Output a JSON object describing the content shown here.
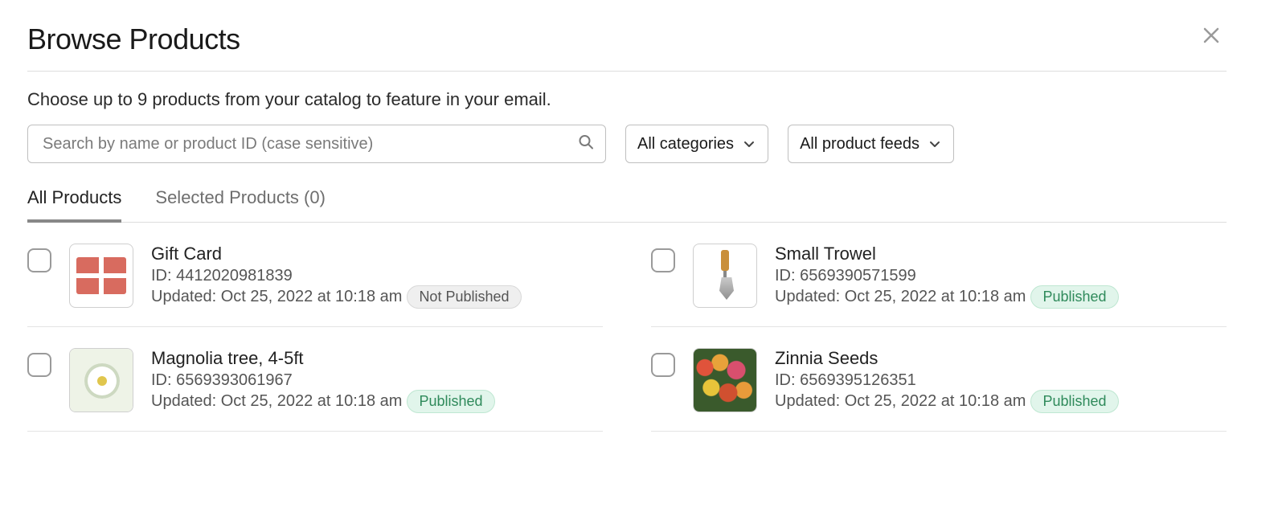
{
  "dialog": {
    "title": "Browse Products",
    "subtitle": "Choose up to 9 products from your catalog to feature in your email."
  },
  "search": {
    "placeholder": "Search by name or product ID (case sensitive)",
    "value": ""
  },
  "filters": {
    "category": "All categories",
    "feed": "All product feeds"
  },
  "tabs": {
    "all": "All Products",
    "selected_label": "Selected Products (0)",
    "selected_count": 0
  },
  "id_prefix": "ID: ",
  "updated_prefix": "Updated: ",
  "status_labels": {
    "published": "Published",
    "not_published": "Not Published"
  },
  "products": [
    {
      "name": "Gift Card",
      "id": "4412020981839",
      "updated": "Oct 25, 2022 at 10:18 am",
      "status": "not_published",
      "thumb": "gift"
    },
    {
      "name": "Small Trowel",
      "id": "6569390571599",
      "updated": "Oct 25, 2022 at 10:18 am",
      "status": "published",
      "thumb": "trowel"
    },
    {
      "name": "Magnolia tree, 4-5ft",
      "id": "6569393061967",
      "updated": "Oct 25, 2022 at 10:18 am",
      "status": "published",
      "thumb": "magnolia"
    },
    {
      "name": "Zinnia Seeds",
      "id": "6569395126351",
      "updated": "Oct 25, 2022 at 10:18 am",
      "status": "published",
      "thumb": "zinnia"
    }
  ]
}
